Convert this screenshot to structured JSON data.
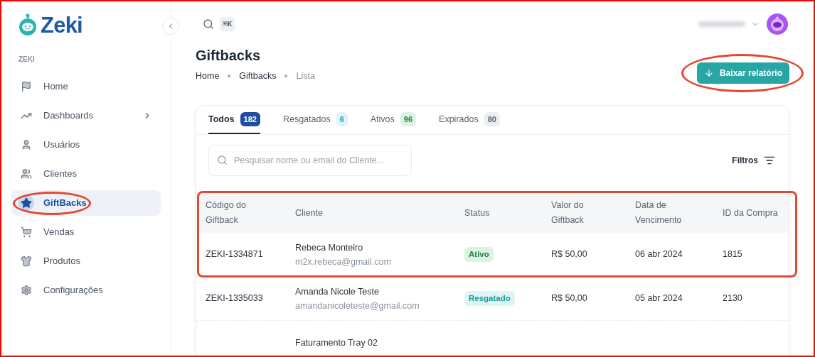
{
  "logo": {
    "text": "Zeki"
  },
  "sidebar": {
    "section": "ZEKI",
    "items": [
      {
        "label": "Home",
        "selected": false,
        "expandable": false,
        "highlighted": false
      },
      {
        "label": "Dashboards",
        "selected": false,
        "expandable": true,
        "highlighted": false
      },
      {
        "label": "Usuários",
        "selected": false,
        "expandable": false,
        "highlighted": false
      },
      {
        "label": "Clientes",
        "selected": false,
        "expandable": false,
        "highlighted": false
      },
      {
        "label": "GiftBacks",
        "selected": true,
        "expandable": false,
        "highlighted": true
      },
      {
        "label": "Vendas",
        "selected": false,
        "expandable": false,
        "highlighted": false
      },
      {
        "label": "Produtos",
        "selected": false,
        "expandable": false,
        "highlighted": false
      },
      {
        "label": "Configurações",
        "selected": false,
        "expandable": false,
        "highlighted": false
      }
    ]
  },
  "topbar": {
    "shortcut": "⌘K"
  },
  "page": {
    "title": "Giftbacks",
    "breadcrumb": [
      "Home",
      "Giftbacks",
      "Lista"
    ]
  },
  "download_button": {
    "label": "Baixar relatório",
    "highlighted": true
  },
  "tabs": [
    {
      "label": "Todos",
      "count": "182",
      "kind": "total",
      "selected": true
    },
    {
      "label": "Resgatados",
      "count": "6",
      "kind": "redeemed",
      "selected": false
    },
    {
      "label": "Ativos",
      "count": "96",
      "kind": "active",
      "selected": false
    },
    {
      "label": "Expirados",
      "count": "80",
      "kind": "expired",
      "selected": false
    }
  ],
  "search": {
    "placeholder": "Pesquisar nome ou email do Cliente..."
  },
  "filters": {
    "label": "Filtros"
  },
  "table": {
    "highlight_header_and_first_row": true,
    "columns": [
      "Código do Giftback",
      "Cliente",
      "Status",
      "Valor do Giftback",
      "Data de Vencimento",
      "ID da Compra"
    ],
    "rows": [
      {
        "code": "ZEKI-1334871",
        "name": "Rebeca Monteiro",
        "email": "m2x.rebeca@gmail.com",
        "status": "Ativo",
        "kind": "active",
        "value": "R$ 50,00",
        "due": "06 abr 2024",
        "purchase_id": "1815"
      },
      {
        "code": "ZEKI-1335033",
        "name": "Amanda Nicole Teste",
        "email": "amandanicoleteste@gmail.com",
        "status": "Resgatado",
        "kind": "redeemed",
        "value": "R$ 50,00",
        "due": "05 abr 2024",
        "purchase_id": "2130"
      },
      {
        "name": "Faturamento Tray 02"
      }
    ]
  }
}
